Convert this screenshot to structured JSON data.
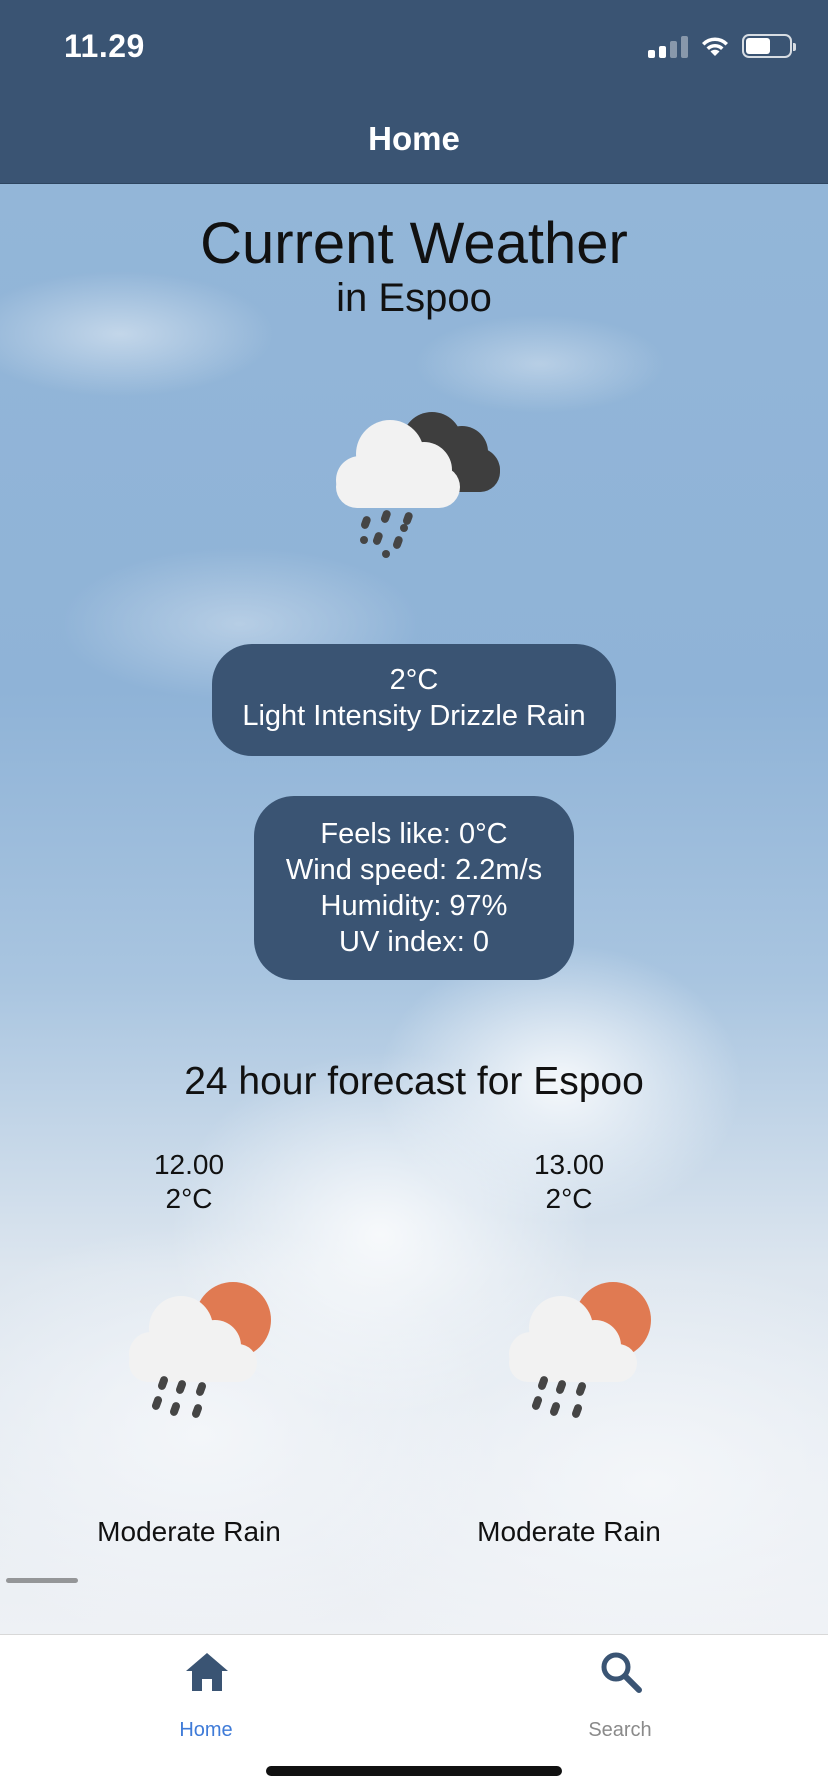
{
  "status_bar": {
    "time": "11.29"
  },
  "nav": {
    "title": "Home"
  },
  "current": {
    "heading": "Current Weather",
    "location_line": "in Espoo",
    "icon": "cloud-drizzle-night-icon",
    "temperature": "2°C",
    "description": "Light Intensity Drizzle Rain",
    "details": {
      "feels_like": "Feels like: 0°C",
      "wind_speed": "Wind speed: 2.2m/s",
      "humidity": "Humidity: 97%",
      "uv_index": "UV index: 0"
    }
  },
  "forecast": {
    "title": "24 hour forecast for Espoo",
    "items": [
      {
        "time": "12.00",
        "temp": "2°C",
        "icon": "cloud-rain-sun-icon",
        "desc": "Moderate Rain"
      },
      {
        "time": "13.00",
        "temp": "2°C",
        "icon": "cloud-rain-sun-icon",
        "desc": "Moderate Rain"
      }
    ]
  },
  "tabs": [
    {
      "label": "Home",
      "icon": "home-icon",
      "active": true
    },
    {
      "label": "Search",
      "icon": "search-icon",
      "active": false
    }
  ],
  "colors": {
    "header": "#3a5473",
    "pill": "#3a5473",
    "active_tab": "#3f7bd8",
    "inactive_tab": "#8a8a8a",
    "sun": "#e07a52"
  }
}
